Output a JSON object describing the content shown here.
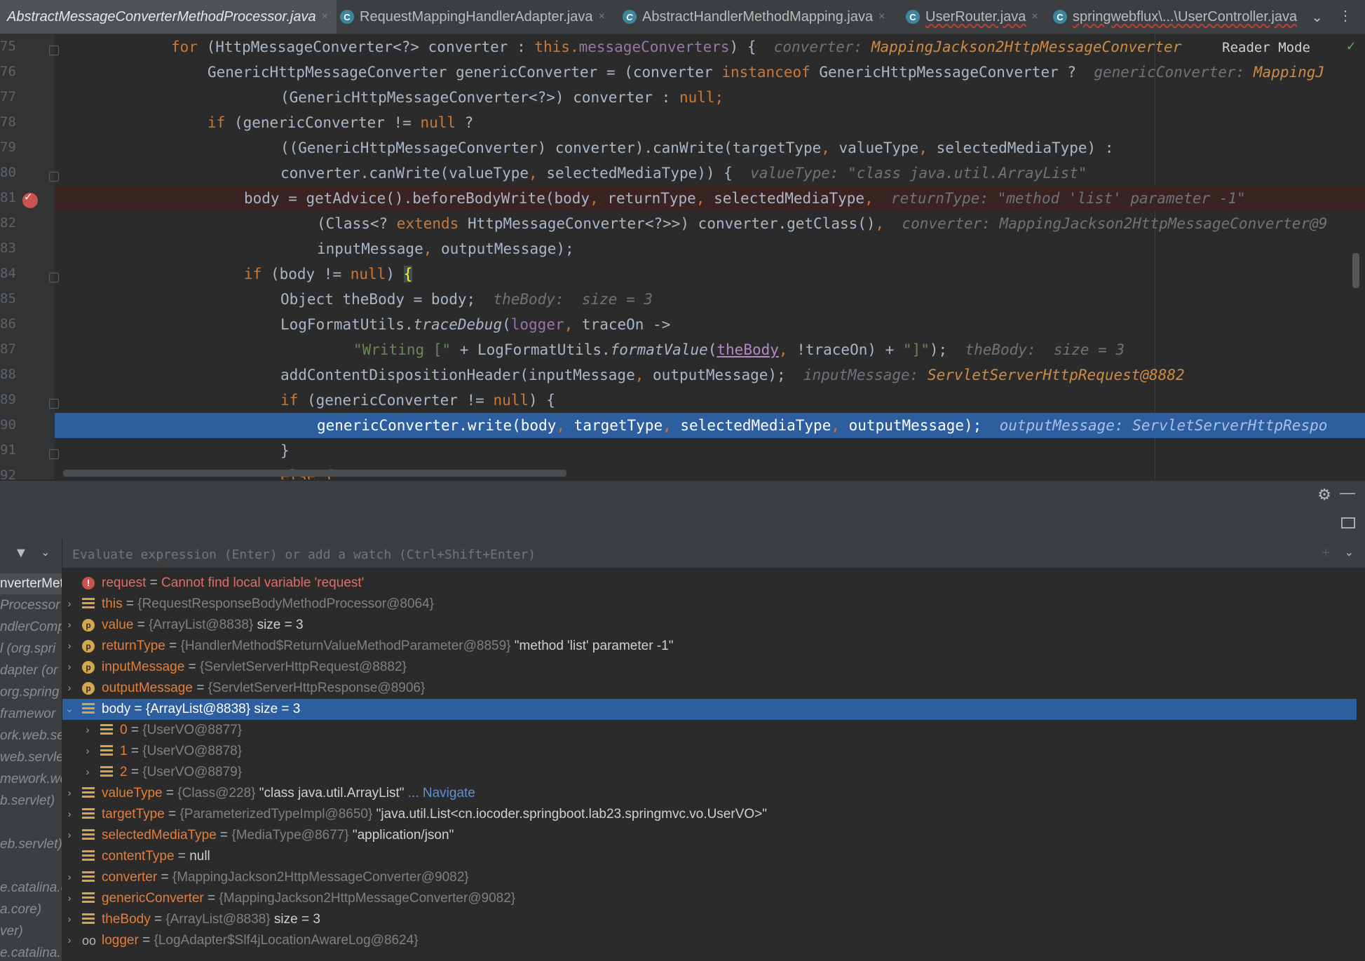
{
  "tabs": [
    {
      "label": "AbstractMessageConverterMethodProcessor.java",
      "active": true,
      "icon": "class-icon",
      "close": "×"
    },
    {
      "label": "RequestMappingHandlerAdapter.java",
      "active": false,
      "icon": "class-icon",
      "close": "×"
    },
    {
      "label": "AbstractHandlerMethodMapping.java",
      "active": false,
      "icon": "class-icon",
      "close": "×"
    },
    {
      "label": "UserRouter.java",
      "active": false,
      "icon": "class-icon",
      "close": "×"
    },
    {
      "label": "springwebflux\\...\\UserController.java",
      "active": false,
      "icon": "class-icon",
      "close": ""
    }
  ],
  "tab_icon_letter": "C",
  "editor": {
    "reader_mode": "Reader Mode",
    "line_numbers": [
      "75",
      "76",
      "77",
      "78",
      "79",
      "80",
      "81",
      "82",
      "83",
      "84",
      "85",
      "86",
      "87",
      "88",
      "89",
      "90",
      "91",
      "92"
    ]
  },
  "code": {
    "l75": {
      "a": "for ",
      "b": "(HttpMessageConverter<?> converter : ",
      "c": "this.",
      "d": "messageConverters",
      "e": ") {  ",
      "h1": "converter: ",
      "h2": "MappingJackson2HttpMessageConverter"
    },
    "l76": {
      "a": "GenericHttpMessageConverter genericConverter = (converter ",
      "b": "instanceof",
      "c": " GenericHttpMessageConverter ?  ",
      "h1": "genericConverter: ",
      "h2": "MappingJ"
    },
    "l77": {
      "a": "(GenericHttpMessageConverter<?>) converter : ",
      "b": "null",
      ";": ";"
    },
    "l78": {
      "a": "if ",
      "b": "(genericConverter != ",
      "c": "null",
      " d": " ?",
      "d": " ?"
    },
    "l79": {
      "a": "((GenericHttpMessageConverter) converter).canWrite(targetType",
      ",": ",",
      "b": " valueType",
      ",2": ",",
      "c": " selectedMediaType) :"
    },
    "l80": {
      "a": "converter.canWrite(valueType",
      ",": ",",
      "b": " selectedMediaType)) {  ",
      "h": "valueType: \"class java.util.ArrayList\""
    },
    "l81": {
      "a": "body = getAdvice().beforeBodyWrite(body",
      ",1": ",",
      "b": " returnType",
      ",2": ",",
      "c": " selectedMediaType",
      ",3": ",",
      "d": "  ",
      "h": "returnType: \"method 'list' parameter -1\""
    },
    "l82": {
      "a": "(Class<? ",
      "b": "extends",
      " c": "",
      "c": " HttpMessageConverter<?>>) converter.getClass()",
      ",": ",",
      "d": "  ",
      "h": "converter: MappingJackson2HttpMessageConverter@9"
    },
    "l83": {
      "a": "inputMessage",
      ",": ",",
      "b": " outputMessage);"
    },
    "l84": {
      "a": "if ",
      "b": "(body != ",
      "c": "null",
      ") {": ") ",
      "d": "{"
    },
    "l85": {
      "a": "Object theBody = body;  ",
      "h1": "theBody: ",
      "h2": " size = 3"
    },
    "l86": {
      "a": "LogFormatUtils.",
      "b": "traceDebug",
      "c": "(",
      "d": "logger",
      ",": ",",
      "e": " traceOn ->"
    },
    "l87": {
      "a": "\"Writing [\"",
      "b": " + LogFormatUtils.",
      "c": "formatValue",
      "d": "(",
      "e": "theBody",
      ",": ",",
      "f": " !traceOn) + ",
      "g": "\"]\"",
      "h": ");  ",
      "h1": "theBody: ",
      "h2": " size = 3"
    },
    "l88": {
      "a": "addContentDispositionHeader(inputMessage",
      ",": ",",
      "b": " outputMessage);  ",
      "h1": "inputMessage: ",
      "h2": "ServletServerHttpRequest@8882"
    },
    "l89": {
      "a": "if ",
      "b": "(genericConverter != ",
      "c": "null",
      ") {": ") {"
    },
    "l90": {
      "a": "genericConverter.write(body",
      ",1": ",",
      "b": " targetType",
      ",2": ",",
      "c": " selectedMediaType",
      ",3": ",",
      "d": " outputMessage);  ",
      "h1": "outputMessage: ",
      "h2": "ServletServerHttpRespo"
    },
    "l91": {
      "a": "}"
    },
    "l92": {
      "a": "else {"
    }
  },
  "debugger": {
    "eval_placeholder": "Evaluate expression (Enter) or add a watch (Ctrl+Shift+Enter)",
    "frames": [
      {
        "label": "nverterMet",
        "selected": true
      },
      {
        "label": "Processor",
        "selected": false
      },
      {
        "label": "ndlerComp",
        "selected": false
      },
      {
        "label": "l (org.spri",
        "selected": false
      },
      {
        "label": "dapter (or",
        "selected": false
      },
      {
        "label": "org.spring",
        "selected": false
      },
      {
        "label": "framewor",
        "selected": false
      },
      {
        "label": "ork.web.se",
        "selected": false
      },
      {
        "label": "web.servle",
        "selected": false
      },
      {
        "label": "mework.we",
        "selected": false
      },
      {
        "label": "b.servlet)",
        "selected": false
      },
      {
        "label": "",
        "selected": false
      },
      {
        "label": "eb.servlet)",
        "selected": false
      },
      {
        "label": "",
        "selected": false
      },
      {
        "label": "e.catalina.c",
        "selected": false
      },
      {
        "label": "a.core)",
        "selected": false
      },
      {
        "label": "ver)",
        "selected": false
      },
      {
        "label": "e.catalina.",
        "selected": false
      }
    ],
    "variables": [
      {
        "indent": 0,
        "arrow": "",
        "icon": "error",
        "name": "request",
        "eq": " = ",
        "obj": "",
        "val": "",
        "err": "Cannot find local variable 'request'",
        "nav": ""
      },
      {
        "indent": 0,
        "arrow": "›",
        "icon": "field",
        "name": "this",
        "eq": " = ",
        "obj": "{RequestResponseBodyMethodProcessor@8064}",
        "val": "",
        "err": "",
        "nav": ""
      },
      {
        "indent": 0,
        "arrow": "›",
        "icon": "param",
        "name": "value",
        "eq": " = ",
        "obj": "{ArrayList@8838}",
        "val": "  size = 3",
        "err": "",
        "nav": ""
      },
      {
        "indent": 0,
        "arrow": "›",
        "icon": "param",
        "name": "returnType",
        "eq": " = ",
        "obj": "{HandlerMethod$ReturnValueMethodParameter@8859}",
        "val": " \"method 'list' parameter -1\"",
        "err": "",
        "nav": ""
      },
      {
        "indent": 0,
        "arrow": "›",
        "icon": "param",
        "name": "inputMessage",
        "eq": " = ",
        "obj": "{ServletServerHttpRequest@8882}",
        "val": "",
        "err": "",
        "nav": ""
      },
      {
        "indent": 0,
        "arrow": "›",
        "icon": "param",
        "name": "outputMessage",
        "eq": " = ",
        "obj": "{ServletServerHttpResponse@8906}",
        "val": "",
        "err": "",
        "nav": ""
      },
      {
        "indent": 0,
        "arrow": "⌄",
        "icon": "field",
        "name": "body",
        "eq": " = ",
        "obj": "{ArrayList@8838}",
        "val": "  size = 3",
        "err": "",
        "nav": "",
        "selected": true
      },
      {
        "indent": 1,
        "arrow": "›",
        "icon": "field",
        "name": "0",
        "eq": " = ",
        "obj": "{UserVO@8877}",
        "val": "",
        "err": "",
        "nav": ""
      },
      {
        "indent": 1,
        "arrow": "›",
        "icon": "field",
        "name": "1",
        "eq": " = ",
        "obj": "{UserVO@8878}",
        "val": "",
        "err": "",
        "nav": ""
      },
      {
        "indent": 1,
        "arrow": "›",
        "icon": "field",
        "name": "2",
        "eq": " = ",
        "obj": "{UserVO@8879}",
        "val": "",
        "err": "",
        "nav": ""
      },
      {
        "indent": 0,
        "arrow": "›",
        "icon": "field",
        "name": "valueType",
        "eq": " = ",
        "obj": "{Class@228}",
        "val": " \"class java.util.ArrayList\"",
        "err": "",
        "nav": " ... Navigate"
      },
      {
        "indent": 0,
        "arrow": "›",
        "icon": "field",
        "name": "targetType",
        "eq": " = ",
        "obj": "{ParameterizedTypeImpl@8650}",
        "val": " \"java.util.List<cn.iocoder.springboot.lab23.springmvc.vo.UserVO>\"",
        "err": "",
        "nav": ""
      },
      {
        "indent": 0,
        "arrow": "›",
        "icon": "field",
        "name": "selectedMediaType",
        "eq": " = ",
        "obj": "{MediaType@8677}",
        "val": " \"application/json\"",
        "err": "",
        "nav": ""
      },
      {
        "indent": 0,
        "arrow": "",
        "icon": "field",
        "name": "contentType",
        "eq": " = ",
        "obj": "",
        "val": "null",
        "err": "",
        "nav": ""
      },
      {
        "indent": 0,
        "arrow": "›",
        "icon": "field",
        "name": "converter",
        "eq": " = ",
        "obj": "{MappingJackson2HttpMessageConverter@9082}",
        "val": "",
        "err": "",
        "nav": ""
      },
      {
        "indent": 0,
        "arrow": "›",
        "icon": "field",
        "name": "genericConverter",
        "eq": " = ",
        "obj": "{MappingJackson2HttpMessageConverter@9082}",
        "val": "",
        "err": "",
        "nav": ""
      },
      {
        "indent": 0,
        "arrow": "›",
        "icon": "field",
        "name": "theBody",
        "eq": " = ",
        "obj": "{ArrayList@8838}",
        "val": "  size = 3",
        "err": "",
        "nav": ""
      },
      {
        "indent": 0,
        "arrow": "›",
        "icon": "watch",
        "name": "logger",
        "eq": " = ",
        "obj": "{LogAdapter$Slf4jLocationAwareLog@8624}",
        "val": "",
        "err": "",
        "nav": ""
      }
    ]
  },
  "colors": {
    "accent": "#2d5ea0",
    "breakpoint": "#c75450",
    "keyword": "#cc7832",
    "field": "#9876aa",
    "string": "#6a8759"
  }
}
